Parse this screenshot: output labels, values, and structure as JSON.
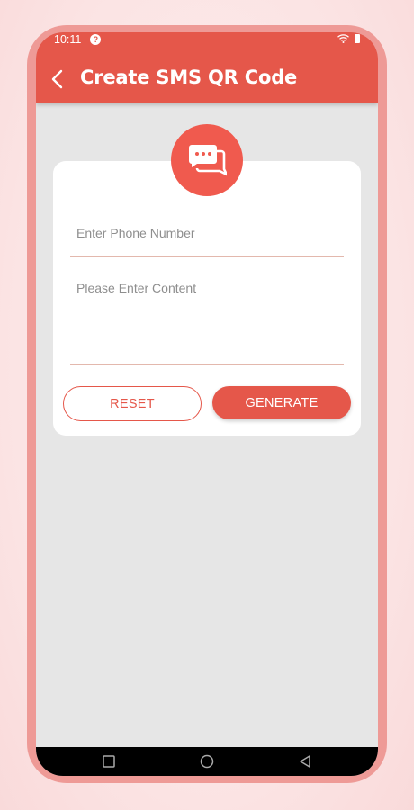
{
  "status_bar": {
    "time": "10:11",
    "help_glyph": "?"
  },
  "header": {
    "title": "Create SMS QR Code",
    "back_icon": "chevron-left-icon"
  },
  "badge": {
    "icon": "chat-bubbles-icon"
  },
  "form": {
    "phone_placeholder": "Enter Phone Number",
    "content_placeholder": "Please Enter Content"
  },
  "buttons": {
    "reset": "RESET",
    "generate": "GENERATE"
  },
  "colors": {
    "accent": "#e5574a",
    "badge": "#f05a4e",
    "frame": "#ee9a96",
    "background": "#e6e6e6"
  }
}
